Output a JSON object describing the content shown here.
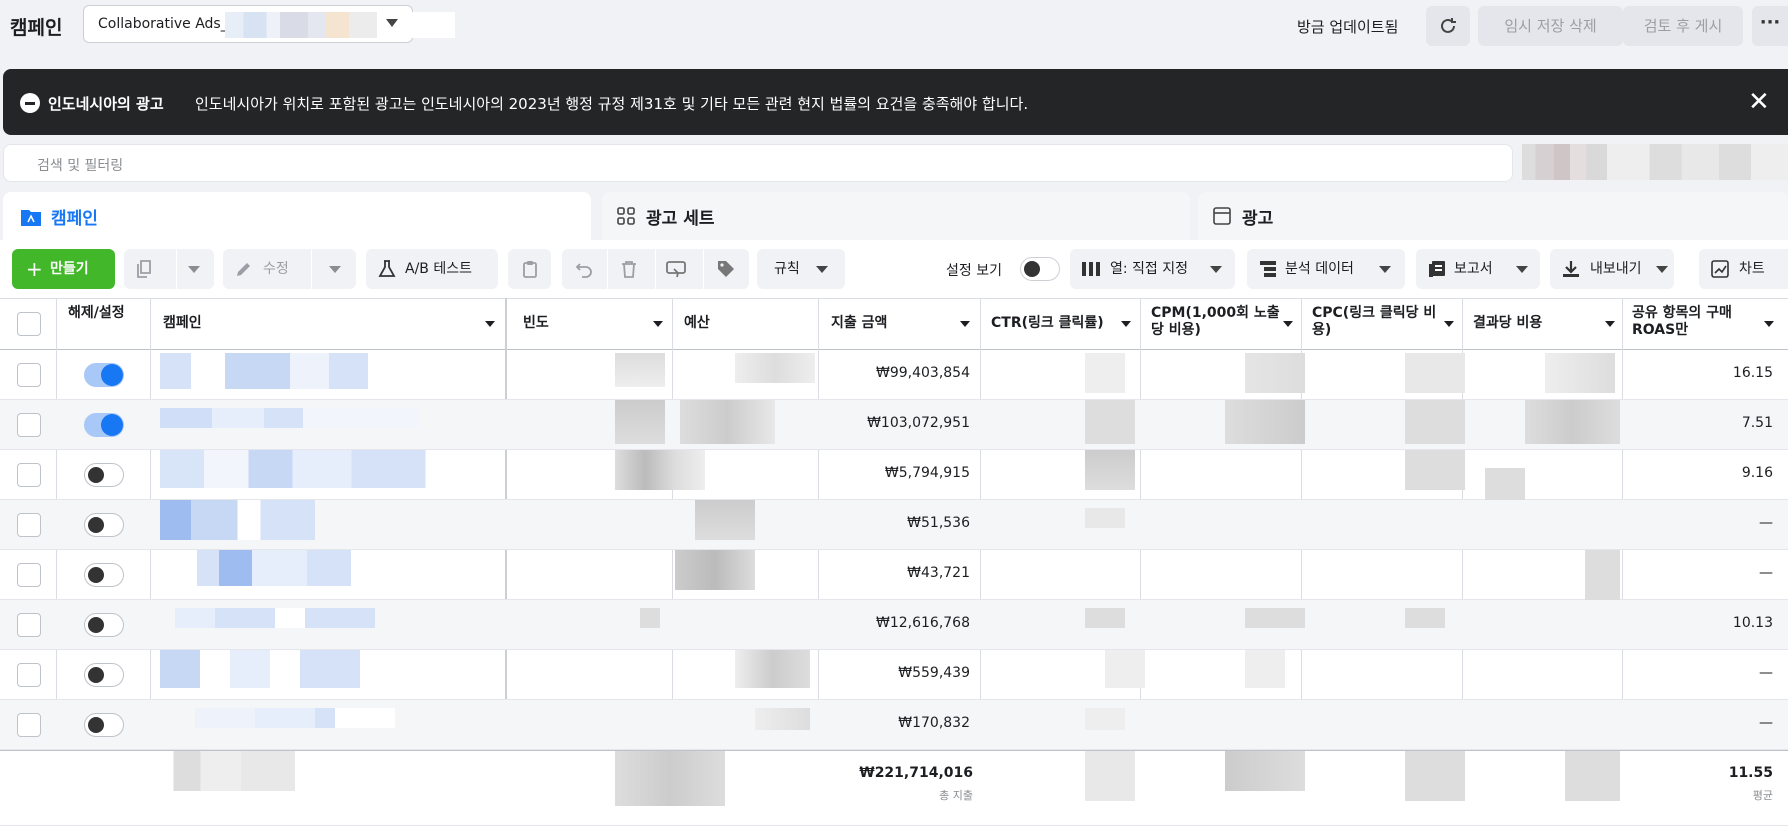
{
  "header": {
    "title": "캠페인",
    "account_label": "Collaborative Ads_",
    "updated_text": "방금 업데이트됨",
    "discard_draft_label": "임시 저장 삭제",
    "review_publish_label": "검토 후 게시",
    "more_label": "···"
  },
  "banner": {
    "title": "인도네시아의 광고",
    "message": "인도네시아가 위치로 포함된 광고는 인도네시아의 2023년 행정 규정 제31호 및 기타 모든 관련 현지 법률의 요건을 충족해야 합니다.",
    "close": "✕"
  },
  "search": {
    "placeholder": "검색 및 필터링"
  },
  "tabs": [
    {
      "label": "캠페인",
      "active": true
    },
    {
      "label": "광고 세트",
      "active": false
    },
    {
      "label": "광고",
      "active": false
    }
  ],
  "toolbar": {
    "create": "만들기",
    "plus": "+",
    "edit": "수정",
    "ab_test": "A/B 테스트",
    "rules": "규칙",
    "view_settings": "설정 보기",
    "columns": "열: 직접 지정",
    "breakdown": "분석 데이터",
    "reports": "보고서",
    "export": "내보내기",
    "charts": "차트"
  },
  "table": {
    "columns": {
      "toggle": "해제/설정",
      "campaign": "캠페인",
      "frequency": "빈도",
      "budget": "예산",
      "spend": "지출 금액",
      "ctr": "CTR(링크 클릭률)",
      "cpm": "CPM(1,000회 노출당 비용)",
      "cpc": "CPC(링크 클릭당 비용)",
      "cost_per_result": "결과당 비용",
      "roas": "공유 항목의 구매 ROAS만"
    },
    "rows": [
      {
        "on": true,
        "spend": "₩99,403,854",
        "roas": "16.15"
      },
      {
        "on": true,
        "spend": "₩103,072,951",
        "roas": "7.51"
      },
      {
        "on": false,
        "spend": "₩5,794,915",
        "roas": "9.16"
      },
      {
        "on": false,
        "spend": "₩51,536",
        "roas": "—"
      },
      {
        "on": false,
        "spend": "₩43,721",
        "roas": "—"
      },
      {
        "on": false,
        "spend": "₩12,616,768",
        "roas": "10.13"
      },
      {
        "on": false,
        "spend": "₩559,439",
        "roas": "—"
      },
      {
        "on": false,
        "spend": "₩170,832",
        "roas": "—"
      }
    ],
    "totals": {
      "spend": "₩221,714,016",
      "spend_label": "총 지출",
      "roas": "11.55",
      "roas_label": "평균"
    }
  },
  "colors": {
    "accent": "#1877f2",
    "create_green": "#42b72a",
    "banner_bg": "#242526"
  }
}
